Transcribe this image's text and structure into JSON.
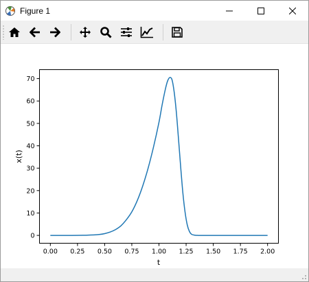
{
  "window": {
    "title": "Figure 1"
  },
  "titlebar_icons": {
    "app": "matplotlib-figure-icon",
    "minimize": "minimize-icon",
    "maximize": "maximize-icon",
    "close": "close-icon"
  },
  "toolbar": {
    "buttons": [
      {
        "name": "home",
        "icon": "home-icon"
      },
      {
        "name": "back",
        "icon": "arrow-left-icon"
      },
      {
        "name": "forward",
        "icon": "arrow-right-icon"
      },
      {
        "name": "pan",
        "icon": "move-icon"
      },
      {
        "name": "zoom",
        "icon": "magnifier-icon"
      },
      {
        "name": "subplots",
        "icon": "sliders-icon"
      },
      {
        "name": "edit-axes",
        "icon": "line-chart-icon"
      },
      {
        "name": "save",
        "icon": "floppy-disk-icon"
      }
    ]
  },
  "colors": {
    "line": "#1f77b4"
  },
  "chart_data": {
    "type": "line",
    "title": "",
    "xlabel": "t",
    "ylabel": "x(t)",
    "xlim": [
      -0.1,
      2.1
    ],
    "ylim": [
      -3.5,
      74
    ],
    "xticks": [
      "0.00",
      "0.25",
      "0.50",
      "0.75",
      "1.00",
      "1.25",
      "1.50",
      "1.75",
      "2.00"
    ],
    "yticks": [
      "0",
      "10",
      "20",
      "30",
      "40",
      "50",
      "60",
      "70"
    ],
    "grid": false,
    "series": [
      {
        "x": [
          0.0,
          0.1,
          0.2,
          0.3,
          0.4,
          0.45,
          0.5,
          0.55,
          0.6,
          0.65,
          0.7,
          0.75,
          0.8,
          0.85,
          0.9,
          0.95,
          1.0,
          1.03,
          1.06,
          1.08,
          1.1,
          1.12,
          1.14,
          1.16,
          1.18,
          1.2,
          1.22,
          1.24,
          1.26,
          1.28,
          1.3,
          1.33,
          1.36,
          1.4,
          1.5,
          1.75,
          2.0
        ],
        "y": [
          0.0,
          0.0,
          0.0,
          0.05,
          0.2,
          0.4,
          0.8,
          1.5,
          2.6,
          4.3,
          7.0,
          10.5,
          15.5,
          22.0,
          30.0,
          39.5,
          50.5,
          58.5,
          65.5,
          69.0,
          70.5,
          69.5,
          64.0,
          55.0,
          43.0,
          30.5,
          19.0,
          10.5,
          4.8,
          1.8,
          0.5,
          0.1,
          0.0,
          0.0,
          0.0,
          0.0,
          0.0
        ]
      }
    ]
  }
}
